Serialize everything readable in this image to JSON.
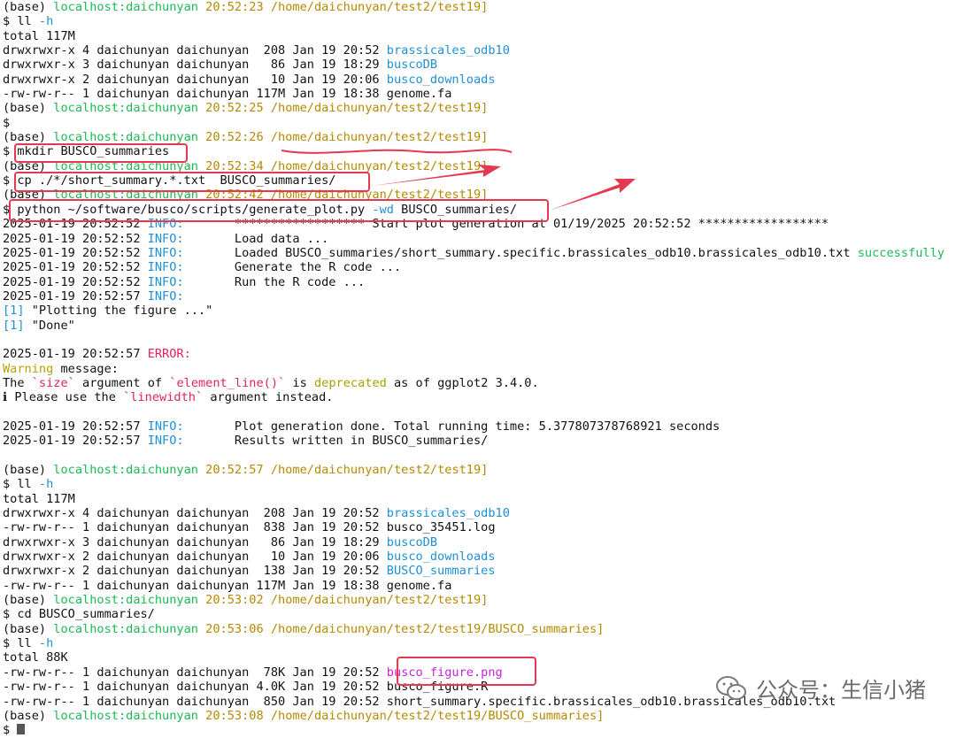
{
  "prompt_prefix": "(base) ",
  "host": "localhost:daichunyan",
  "lines": [
    {
      "t": "prompt",
      "time": "20:52:23",
      "path": "/home/daichunyan/test2/test19]"
    },
    {
      "t": "cmd",
      "parts": [
        {
          "c": "",
          "s": "$ ll "
        },
        {
          "c": "b",
          "s": "-h"
        }
      ]
    },
    {
      "t": "plain",
      "s": "total 117M"
    },
    {
      "t": "ls",
      "pre": "drwxrwxr-x 4 daichunyan daichunyan  208 Jan 19 20:52 ",
      "name": "brassicales_odb10",
      "c": "b"
    },
    {
      "t": "ls",
      "pre": "drwxrwxr-x 3 daichunyan daichunyan   86 Jan 19 18:29 ",
      "name": "buscoDB",
      "c": "b"
    },
    {
      "t": "ls",
      "pre": "drwxrwxr-x 2 daichunyan daichunyan   10 Jan 19 20:06 ",
      "name": "busco_downloads",
      "c": "b"
    },
    {
      "t": "ls",
      "pre": "-rw-rw-r-- 1 daichunyan daichunyan 117M Jan 19 18:38 ",
      "name": "genome.fa",
      "c": ""
    },
    {
      "t": "prompt",
      "time": "20:52:25",
      "path": "/home/daichunyan/test2/test19]"
    },
    {
      "t": "cmd",
      "parts": [
        {
          "c": "",
          "s": "$"
        }
      ]
    },
    {
      "t": "prompt",
      "time": "20:52:26",
      "path": "/home/daichunyan/test2/test19]"
    },
    {
      "t": "cmd",
      "parts": [
        {
          "c": "",
          "s": "$ mkdir BUSCO_summaries"
        }
      ]
    },
    {
      "t": "prompt",
      "time": "20:52:34",
      "path": "/home/daichunyan/test2/test19]"
    },
    {
      "t": "cmd",
      "parts": [
        {
          "c": "",
          "s": "$ cp ./*/short_summary.*.txt  BUSCO_summaries/"
        }
      ]
    },
    {
      "t": "prompt",
      "time": "20:52:42",
      "path": "/home/daichunyan/test2/test19]"
    },
    {
      "t": "cmd",
      "parts": [
        {
          "c": "",
          "s": "$ python ~/software/busco/scripts/generate_plot.py "
        },
        {
          "c": "b",
          "s": "-wd"
        },
        {
          "c": "",
          "s": " BUSCO_summaries/"
        }
      ]
    },
    {
      "t": "log",
      "ts": "2025-01-19 20:52:52 ",
      "lvl": "INFO:",
      "lc": "b",
      "msg": "       ****************** Start plot generation at 01/19/2025 20:52:52 ******************"
    },
    {
      "t": "log",
      "ts": "2025-01-19 20:52:52 ",
      "lvl": "INFO:",
      "lc": "b",
      "msg": "       Load data ..."
    },
    {
      "t": "log",
      "ts": "2025-01-19 20:52:52 ",
      "lvl": "INFO:",
      "lc": "b",
      "msg": "       Loaded BUSCO_summaries/short_summary.specific.brassicales_odb10.brassicales_odb10.txt ",
      "tail": "successfully"
    },
    {
      "t": "log",
      "ts": "2025-01-19 20:52:52 ",
      "lvl": "INFO:",
      "lc": "b",
      "msg": "       Generate the R code ..."
    },
    {
      "t": "log",
      "ts": "2025-01-19 20:52:52 ",
      "lvl": "INFO:",
      "lc": "b",
      "msg": "       Run the R code ..."
    },
    {
      "t": "log",
      "ts": "2025-01-19 20:52:57 ",
      "lvl": "INFO:",
      "lc": "b",
      "msg": ""
    },
    {
      "t": "cmd",
      "parts": [
        {
          "c": "b",
          "s": "[1]"
        },
        {
          "c": "",
          "s": " \"Plotting the figure ...\""
        }
      ]
    },
    {
      "t": "cmd",
      "parts": [
        {
          "c": "b",
          "s": "[1]"
        },
        {
          "c": "",
          "s": " \"Done\""
        }
      ]
    },
    {
      "t": "plain",
      "s": ""
    },
    {
      "t": "log",
      "ts": "2025-01-19 20:52:57 ",
      "lvl": "ERROR:",
      "lc": "r",
      "msg": ""
    },
    {
      "t": "cmd",
      "parts": [
        {
          "c": "wn",
          "s": "Warning"
        },
        {
          "c": "",
          "s": " message:"
        }
      ]
    },
    {
      "t": "cmd",
      "parts": [
        {
          "c": "",
          "s": "The "
        },
        {
          "c": "r",
          "s": "`size`"
        },
        {
          "c": "",
          "s": " argument of "
        },
        {
          "c": "r",
          "s": "`element_line()`"
        },
        {
          "c": "",
          "s": " is "
        },
        {
          "c": "dp",
          "s": "deprecated"
        },
        {
          "c": "",
          "s": " as of ggplot2 3.4.0."
        }
      ]
    },
    {
      "t": "cmd",
      "parts": [
        {
          "c": "",
          "s": "ℹ Please use the "
        },
        {
          "c": "r",
          "s": "`linewidth`"
        },
        {
          "c": "",
          "s": " argument instead."
        }
      ]
    },
    {
      "t": "plain",
      "s": ""
    },
    {
      "t": "log",
      "ts": "2025-01-19 20:52:57 ",
      "lvl": "INFO:",
      "lc": "b",
      "msg": "       Plot generation done. Total running time: 5.377807378768921 seconds"
    },
    {
      "t": "log",
      "ts": "2025-01-19 20:52:57 ",
      "lvl": "INFO:",
      "lc": "b",
      "msg": "       Results written in BUSCO_summaries/"
    },
    {
      "t": "plain",
      "s": ""
    },
    {
      "t": "prompt",
      "time": "20:52:57",
      "path": "/home/daichunyan/test2/test19]"
    },
    {
      "t": "cmd",
      "parts": [
        {
          "c": "",
          "s": "$ ll "
        },
        {
          "c": "b",
          "s": "-h"
        }
      ]
    },
    {
      "t": "plain",
      "s": "total 117M"
    },
    {
      "t": "ls",
      "pre": "drwxrwxr-x 4 daichunyan daichunyan  208 Jan 19 20:52 ",
      "name": "brassicales_odb10",
      "c": "b"
    },
    {
      "t": "ls",
      "pre": "-rw-rw-r-- 1 daichunyan daichunyan  838 Jan 19 20:52 ",
      "name": "busco_35451.log",
      "c": ""
    },
    {
      "t": "ls",
      "pre": "drwxrwxr-x 3 daichunyan daichunyan   86 Jan 19 18:29 ",
      "name": "buscoDB",
      "c": "b"
    },
    {
      "t": "ls",
      "pre": "drwxrwxr-x 2 daichunyan daichunyan   10 Jan 19 20:06 ",
      "name": "busco_downloads",
      "c": "b"
    },
    {
      "t": "ls",
      "pre": "drwxrwxr-x 2 daichunyan daichunyan  138 Jan 19 20:52 ",
      "name": "BUSCO_summaries",
      "c": "b"
    },
    {
      "t": "ls",
      "pre": "-rw-rw-r-- 1 daichunyan daichunyan 117M Jan 19 18:38 ",
      "name": "genome.fa",
      "c": ""
    },
    {
      "t": "prompt",
      "time": "20:53:02",
      "path": "/home/daichunyan/test2/test19]"
    },
    {
      "t": "cmd",
      "parts": [
        {
          "c": "",
          "s": "$ cd BUSCO_summaries/"
        }
      ]
    },
    {
      "t": "prompt",
      "time": "20:53:06",
      "path": "/home/daichunyan/test2/test19/BUSCO_summaries]"
    },
    {
      "t": "cmd",
      "parts": [
        {
          "c": "",
          "s": "$ ll "
        },
        {
          "c": "b",
          "s": "-h"
        }
      ]
    },
    {
      "t": "plain",
      "s": "total 88K"
    },
    {
      "t": "ls",
      "pre": "-rw-rw-r-- 1 daichunyan daichunyan  78K Jan 19 20:52 ",
      "name": "busco_figure.png",
      "c": "m"
    },
    {
      "t": "ls",
      "pre": "-rw-rw-r-- 1 daichunyan daichunyan 4.0K Jan 19 20:52 ",
      "name": "busco_figure.R",
      "c": ""
    },
    {
      "t": "ls",
      "pre": "-rw-rw-r-- 1 daichunyan daichunyan  850 Jan 19 20:52 ",
      "name": "short_summary.specific.brassicales_odb10.brassicales_odb10.txt",
      "c": ""
    },
    {
      "t": "prompt",
      "time": "20:53:08",
      "path": "/home/daichunyan/test2/test19/BUSCO_summaries]"
    },
    {
      "t": "cursor",
      "s": "$ "
    }
  ],
  "watermark": "公众号：生信小猪",
  "colors": {
    "accent": "#e53950",
    "host": "#1db954",
    "path": "#b58900",
    "dir": "#1e90d6",
    "image": "#c026d3"
  }
}
